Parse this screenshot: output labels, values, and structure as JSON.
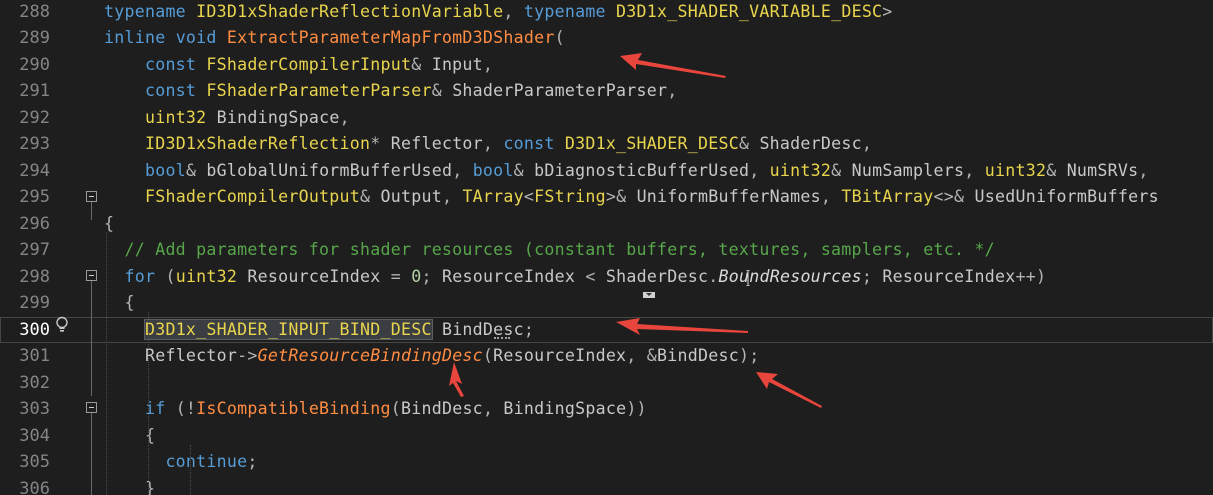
{
  "editor": {
    "colors": {
      "background": "#1e1e1e",
      "keyword": "#569cd6",
      "function": "#ff8c42",
      "class": "#e8d44d",
      "comment": "#57a64a",
      "annotation_arrow": "#e8463c"
    },
    "active_line": "300",
    "lines": [
      {
        "num": "288",
        "tokens": [
          {
            "t": "typename ",
            "c": "kw"
          },
          {
            "t": "ID3D1xShaderReflectionVariable",
            "c": "cl"
          },
          {
            "t": ", ",
            "c": "op"
          },
          {
            "t": "typename ",
            "c": "kw"
          },
          {
            "t": "D3D1x_SHADER_VARIABLE_DESC",
            "c": "cl"
          },
          {
            "t": ">",
            "c": "op"
          }
        ]
      },
      {
        "num": "289",
        "tokens": [
          {
            "t": "inline ",
            "c": "kw"
          },
          {
            "t": "void ",
            "c": "kw"
          },
          {
            "t": "ExtractParameterMapFromD3DShader",
            "c": "fn"
          },
          {
            "t": "(",
            "c": "op"
          }
        ]
      },
      {
        "num": "290",
        "tokens": [
          {
            "t": "    const ",
            "c": "kw"
          },
          {
            "t": "FShaderCompilerInput",
            "c": "cl"
          },
          {
            "t": "& ",
            "c": "op"
          },
          {
            "t": "Input",
            "c": "pr"
          },
          {
            "t": ",",
            "c": "op"
          }
        ]
      },
      {
        "num": "291",
        "tokens": [
          {
            "t": "    const ",
            "c": "kw"
          },
          {
            "t": "FShaderParameterParser",
            "c": "cl"
          },
          {
            "t": "& ",
            "c": "op"
          },
          {
            "t": "ShaderParameterParser",
            "c": "pr"
          },
          {
            "t": ",",
            "c": "op"
          }
        ]
      },
      {
        "num": "292",
        "tokens": [
          {
            "t": "    ",
            "c": "op"
          },
          {
            "t": "uint32",
            "c": "cl"
          },
          {
            "t": " ",
            "c": "op"
          },
          {
            "t": "BindingSpace",
            "c": "pr"
          },
          {
            "t": ",",
            "c": "op"
          }
        ]
      },
      {
        "num": "293",
        "tokens": [
          {
            "t": "    ",
            "c": "op"
          },
          {
            "t": "ID3D1xShaderReflection",
            "c": "cl"
          },
          {
            "t": "* ",
            "c": "op"
          },
          {
            "t": "Reflector",
            "c": "pr"
          },
          {
            "t": ", ",
            "c": "op"
          },
          {
            "t": "const ",
            "c": "kw"
          },
          {
            "t": "D3D1x_SHADER_DESC",
            "c": "cl"
          },
          {
            "t": "& ",
            "c": "op"
          },
          {
            "t": "ShaderDesc",
            "c": "pr"
          },
          {
            "t": ",",
            "c": "op"
          }
        ]
      },
      {
        "num": "294",
        "tokens": [
          {
            "t": "    bool",
            "c": "kw"
          },
          {
            "t": "& ",
            "c": "op"
          },
          {
            "t": "bGlobalUniformBufferUsed",
            "c": "pr"
          },
          {
            "t": ", ",
            "c": "op"
          },
          {
            "t": "bool",
            "c": "kw"
          },
          {
            "t": "& ",
            "c": "op"
          },
          {
            "t": "bDiagnosticBufferUsed",
            "c": "pr"
          },
          {
            "t": ", ",
            "c": "op"
          },
          {
            "t": "uint32",
            "c": "cl"
          },
          {
            "t": "& ",
            "c": "op"
          },
          {
            "t": "NumSamplers",
            "c": "pr"
          },
          {
            "t": ", ",
            "c": "op"
          },
          {
            "t": "uint32",
            "c": "cl"
          },
          {
            "t": "& ",
            "c": "op"
          },
          {
            "t": "NumSRVs",
            "c": "pr"
          },
          {
            "t": ",",
            "c": "op"
          }
        ]
      },
      {
        "num": "295",
        "tokens": [
          {
            "t": "    ",
            "c": "op"
          },
          {
            "t": "FShaderCompilerOutput",
            "c": "cl"
          },
          {
            "t": "& ",
            "c": "op"
          },
          {
            "t": "Output",
            "c": "pr"
          },
          {
            "t": ", ",
            "c": "op"
          },
          {
            "t": "TArray",
            "c": "cl"
          },
          {
            "t": "<",
            "c": "op"
          },
          {
            "t": "FString",
            "c": "cl"
          },
          {
            "t": ">& ",
            "c": "op"
          },
          {
            "t": "UniformBufferNames",
            "c": "pr"
          },
          {
            "t": ", ",
            "c": "op"
          },
          {
            "t": "TBitArray",
            "c": "cl"
          },
          {
            "t": "<>& ",
            "c": "op"
          },
          {
            "t": "UsedUniformBuffers",
            "c": "pr"
          }
        ]
      },
      {
        "num": "296",
        "tokens": [
          {
            "t": "{",
            "c": "op"
          }
        ]
      },
      {
        "num": "297",
        "tokens": [
          {
            "t": "  // Add parameters for shader resources (constant buffers, textures, samplers, etc. */",
            "c": "cm"
          }
        ]
      },
      {
        "num": "298",
        "tokens": [
          {
            "t": "  for ",
            "c": "kw"
          },
          {
            "t": "(",
            "c": "op"
          },
          {
            "t": "uint32",
            "c": "cl"
          },
          {
            "t": " ",
            "c": "op"
          },
          {
            "t": "ResourceIndex",
            "c": "pr"
          },
          {
            "t": " = ",
            "c": "op"
          },
          {
            "t": "0",
            "c": "nm"
          },
          {
            "t": "; ",
            "c": "op"
          },
          {
            "t": "ResourceIndex",
            "c": "pr"
          },
          {
            "t": " < ",
            "c": "op"
          },
          {
            "t": "ShaderDesc",
            "c": "pr"
          },
          {
            "t": ".",
            "c": "op"
          },
          {
            "t": "BoundResources",
            "c": "fld"
          },
          {
            "t": "; ",
            "c": "op"
          },
          {
            "t": "ResourceIndex",
            "c": "pr"
          },
          {
            "t": "++)",
            "c": "op"
          }
        ]
      },
      {
        "num": "299",
        "tokens": [
          {
            "t": "  {",
            "c": "op"
          }
        ]
      },
      {
        "num": "300",
        "tokens": [
          {
            "t": "    ",
            "c": "op"
          },
          {
            "t": "D3D1x_SHADER_INPUT_BIND_DESC",
            "c": "cl hl"
          },
          {
            "t": " ",
            "c": "op"
          },
          {
            "t": "BindDesc",
            "c": "pr"
          },
          {
            "t": ";",
            "c": "op"
          }
        ]
      },
      {
        "num": "301",
        "tokens": [
          {
            "t": "    ",
            "c": "op"
          },
          {
            "t": "Reflector",
            "c": "pr"
          },
          {
            "t": "->",
            "c": "op"
          },
          {
            "t": "GetResourceBindingDesc",
            "c": "fni"
          },
          {
            "t": "(",
            "c": "op"
          },
          {
            "t": "ResourceIndex",
            "c": "pr"
          },
          {
            "t": ", &",
            "c": "op"
          },
          {
            "t": "BindDesc",
            "c": "pr"
          },
          {
            "t": ");",
            "c": "op"
          }
        ]
      },
      {
        "num": "302",
        "tokens": []
      },
      {
        "num": "303",
        "tokens": [
          {
            "t": "    if ",
            "c": "kw"
          },
          {
            "t": "(!",
            "c": "op"
          },
          {
            "t": "IsCompatibleBinding",
            "c": "fn"
          },
          {
            "t": "(",
            "c": "op"
          },
          {
            "t": "BindDesc",
            "c": "pr"
          },
          {
            "t": ", ",
            "c": "op"
          },
          {
            "t": "BindingSpace",
            "c": "pr"
          },
          {
            "t": "))",
            "c": "op"
          }
        ]
      },
      {
        "num": "304",
        "tokens": [
          {
            "t": "    {",
            "c": "op"
          }
        ]
      },
      {
        "num": "305",
        "tokens": [
          {
            "t": "      continue",
            "c": "kw"
          },
          {
            "t": ";",
            "c": "op"
          }
        ]
      },
      {
        "num": "306",
        "tokens": [
          {
            "t": "    }",
            "c": "op"
          }
        ]
      }
    ]
  }
}
